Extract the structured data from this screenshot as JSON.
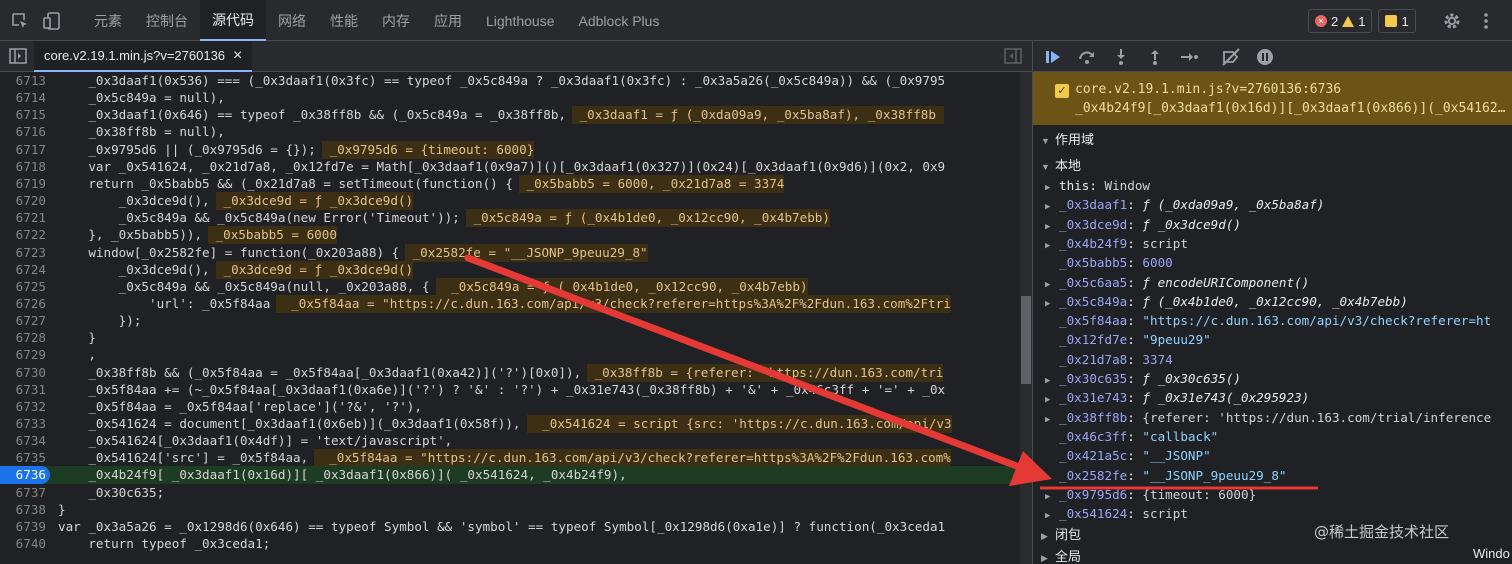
{
  "topbar": {
    "tabs": [
      "元素",
      "控制台",
      "源代码",
      "网络",
      "性能",
      "内存",
      "应用",
      "Lighthouse",
      "Adblock Plus"
    ],
    "active_tab": 2,
    "errors": "2",
    "warnings": "1",
    "issues": "1"
  },
  "filebar": {
    "file_name": "core.v2.19.1.min.js?v=2760136",
    "close": "×"
  },
  "lines": [
    {
      "n": "6713",
      "t": "    _0x3daaf1(0x536) === (_0x3daaf1(0x3fc) == typeof _0x5c849a ? _0x3daaf1(0x3fc) : _0x3a5a26(_0x5c849a)) && (_0x9795"
    },
    {
      "n": "6714",
      "t": "    _0x5c849a = null),"
    },
    {
      "n": "6715",
      "t": "    _0x3daaf1(0x646) == typeof _0x38ff8b && (_0x5c849a = _0x38ff8b,",
      "i": " _0x3daaf1 = ƒ (_0xda09a9, _0x5ba8af), _0x38ff8b "
    },
    {
      "n": "6716",
      "t": "    _0x38ff8b = null),"
    },
    {
      "n": "6717",
      "t": "    _0x9795d6 || (_0x9795d6 = {});",
      "i": " _0x9795d6 = {timeout: 6000}"
    },
    {
      "n": "6718",
      "t": "    var _0x541624, _0x21d7a8, _0x12fd7e = Math[_0x3daaf1(0x9a7)]()[_0x3daaf1(0x327)](0x24)[_0x3daaf1(0x9d6)](0x2, 0x9"
    },
    {
      "n": "6719",
      "t": "    return _0x5babb5 && (_0x21d7a8 = setTimeout(function() {",
      "i": " _0x5babb5 = 6000, _0x21d7a8 = 3374"
    },
    {
      "n": "6720",
      "t": "        _0x3dce9d(),",
      "i": " _0x3dce9d = ƒ _0x3dce9d()"
    },
    {
      "n": "6721",
      "t": "        _0x5c849a && _0x5c849a(new Error('Timeout'));",
      "i": " _0x5c849a = ƒ (_0x4b1de0, _0x12cc90, _0x4b7ebb)"
    },
    {
      "n": "6722",
      "t": "    }, _0x5babb5)),",
      "i": " _0x5babb5 = 6000"
    },
    {
      "n": "6723",
      "t": "    window[_0x2582fe] = function(_0x203a88) {",
      "i": " _0x2582fe = \"__JSONP_9peuu29_8\""
    },
    {
      "n": "6724",
      "t": "        _0x3dce9d(),",
      "i": " _0x3dce9d = ƒ _0x3dce9d()"
    },
    {
      "n": "6725",
      "t": "        _0x5c849a && _0x5c849a(null, _0x203a88, {",
      "i": "  _0x5c849a = ƒ (_0x4b1de0, _0x12cc90, _0x4b7ebb)"
    },
    {
      "n": "6726",
      "t": "            'url': _0x5f84aa",
      "i": "  _0x5f84aa = \"https://c.dun.163.com/api/v3/check?referer=https%3A%2F%2Fdun.163.com%2Ftri"
    },
    {
      "n": "6727",
      "t": "        });"
    },
    {
      "n": "6728",
      "t": "    }"
    },
    {
      "n": "6729",
      "t": "    ,"
    },
    {
      "n": "6730",
      "t": "    _0x38ff8b && (_0x5f84aa = _0x5f84aa[_0x3daaf1(0xa42)]('?')[0x0]),",
      "i": " _0x38ff8b = {referer: 'https://dun.163.com/tri"
    },
    {
      "n": "6731",
      "t": "    _0x5f84aa += (~_0x5f84aa[_0x3daaf1(0xa6e)]('?') ? '&' : '?') + _0x31e743(_0x38ff8b) + '&' + _0x46c3ff + '=' + _0x"
    },
    {
      "n": "6732",
      "t": "    _0x5f84aa = _0x5f84aa['replace']('?&', '?'),"
    },
    {
      "n": "6733",
      "t": "    _0x541624 = document[_0x3daaf1(0x6eb)](_0x3daaf1(0x58f)),",
      "i": "  _0x541624 = script {src: 'https://c.dun.163.com/api/v3"
    },
    {
      "n": "6734",
      "t": "    _0x541624[_0x3daaf1(0x4df)] = 'text/javascript',"
    },
    {
      "n": "6735",
      "t": "    _0x541624['src'] = _0x5f84aa,",
      "i": "  _0x5f84aa = \"https://c.dun.163.com/api/v3/check?referer=https%3A%2F%2Fdun.163.com%"
    },
    {
      "n": "6736",
      "t": "    _0x4b24f9[ _0x3daaf1(0x16d)][ _0x3daaf1(0x866)]( _0x541624, _0x4b24f9),",
      "exec": true
    },
    {
      "n": "6737",
      "t": "    _0x30c635;"
    },
    {
      "n": "6738",
      "t": "}"
    },
    {
      "n": "6739",
      "t": "var _0x3a5a26 = _0x1298d6(0x646) == typeof Symbol && 'symbol' == typeof Symbol[_0x1298d6(0xa1e)] ? function(_0x3ceda1"
    },
    {
      "n": "6740",
      "t": "    return typeof _0x3ceda1;"
    }
  ],
  "paused": {
    "location": "core.v2.19.1.min.js?v=2760136:6736",
    "code": "_0x4b24f9[_0x3daaf1(0x16d)][_0x3daaf1(0x866)](_0x54162…"
  },
  "scope": {
    "section_title": "作用域",
    "local_title": "本地",
    "closure_title": "闭包",
    "global_title": "全局",
    "global_value": "Windo",
    "vars": [
      {
        "name": "this",
        "value": "Window",
        "kind": "obj",
        "exp": true
      },
      {
        "name": "_0x3daaf1",
        "value": "ƒ (_0xda09a9, _0x5ba8af)",
        "kind": "fn",
        "exp": true
      },
      {
        "name": "_0x3dce9d",
        "value": "ƒ _0x3dce9d()",
        "kind": "fn",
        "exp": true
      },
      {
        "name": "_0x4b24f9",
        "value": "script",
        "kind": "obj",
        "exp": true
      },
      {
        "name": "_0x5babb5",
        "value": "6000",
        "kind": "num",
        "exp": false
      },
      {
        "name": "_0x5c6aa5",
        "value": "ƒ encodeURIComponent()",
        "kind": "fn",
        "exp": true
      },
      {
        "name": "_0x5c849a",
        "value": "ƒ (_0x4b1de0, _0x12cc90, _0x4b7ebb)",
        "kind": "fn",
        "exp": true
      },
      {
        "name": "_0x5f84aa",
        "value": "\"https://c.dun.163.com/api/v3/check?referer=ht",
        "kind": "str",
        "exp": false
      },
      {
        "name": "_0x12fd7e",
        "value": "\"9peuu29\"",
        "kind": "str",
        "exp": false
      },
      {
        "name": "_0x21d7a8",
        "value": "3374",
        "kind": "num",
        "exp": false
      },
      {
        "name": "_0x30c635",
        "value": "ƒ _0x30c635()",
        "kind": "fn",
        "exp": true
      },
      {
        "name": "_0x31e743",
        "value": "ƒ _0x31e743(_0x295923)",
        "kind": "fn",
        "exp": true
      },
      {
        "name": "_0x38ff8b",
        "value": "{referer: 'https://dun.163.com/trial/inference",
        "kind": "obj",
        "exp": true
      },
      {
        "name": "_0x46c3ff",
        "value": "\"callback\"",
        "kind": "str",
        "exp": false
      },
      {
        "name": "_0x421a5c",
        "value": "\"__JSONP\"",
        "kind": "str",
        "exp": false
      },
      {
        "name": "_0x2582fe",
        "value": "\"__JSONP_9peuu29_8\"",
        "kind": "str",
        "exp": false
      },
      {
        "name": "_0x9795d6",
        "value": "{timeout: 6000}",
        "kind": "obj",
        "exp": true
      },
      {
        "name": "_0x541624",
        "value": "script",
        "kind": "obj",
        "exp": true
      }
    ]
  },
  "watermark": "@稀土掘金技术社区",
  "colors": {
    "annotation": "#e53935",
    "exec_line": "#1e3c23",
    "paused_banner": "#6b5415"
  }
}
